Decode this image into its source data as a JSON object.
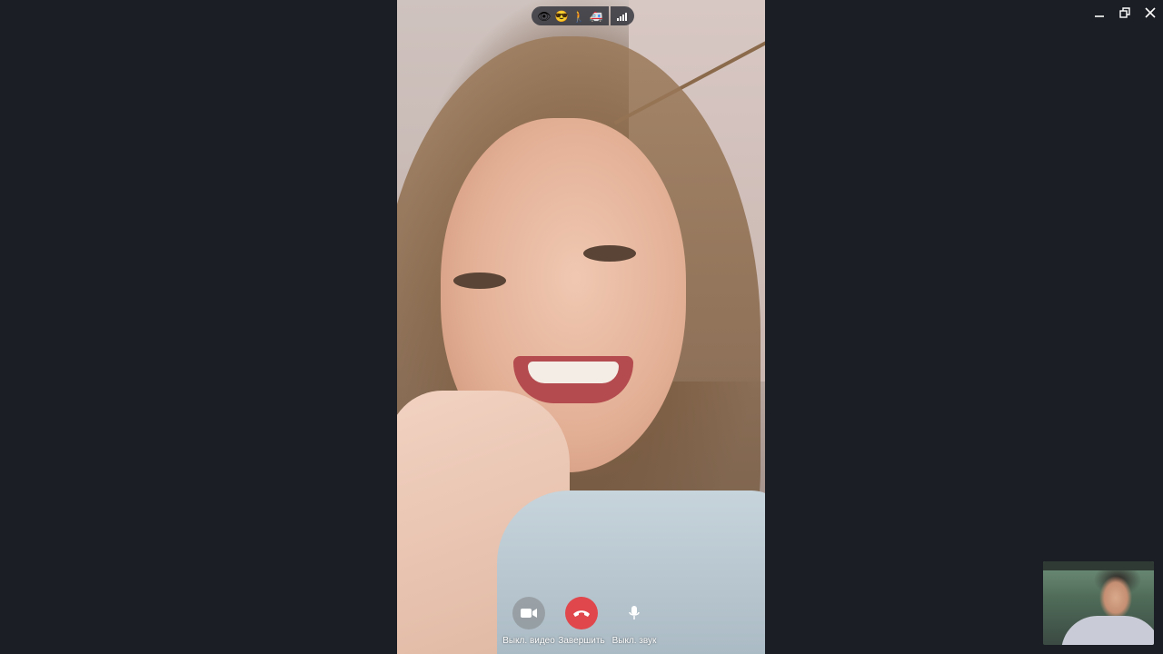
{
  "window": {
    "controls": {
      "minimize_icon": "minimize-icon",
      "restore_icon": "restore-icon",
      "close_icon": "close-icon"
    }
  },
  "call": {
    "status_emojis": [
      "👁",
      "😎",
      "🚶",
      "🚑"
    ],
    "signal_icon": "signal-bars-icon",
    "controls": {
      "video_off_label": "Выкл. видео",
      "end_call_label": "Завершить",
      "mute_label": "Выкл. звук"
    },
    "colors": {
      "end_call": "#e0474c",
      "background": "#1b1e24"
    }
  }
}
